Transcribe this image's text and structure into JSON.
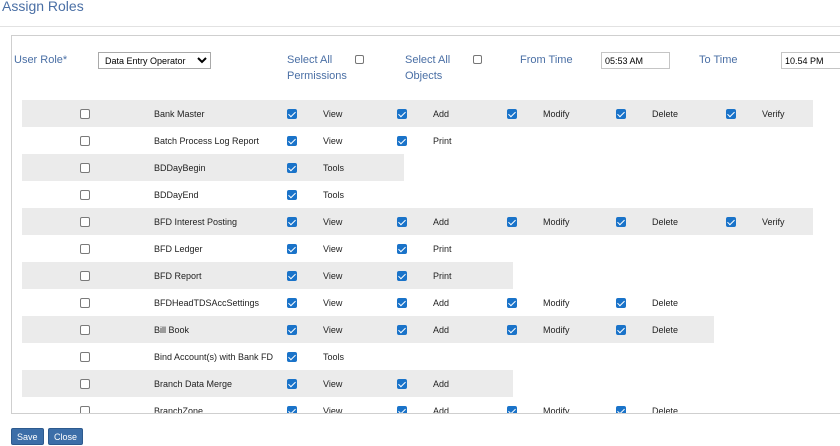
{
  "page": {
    "title": "Assign Roles"
  },
  "filters": {
    "user_role_label": "User Role*",
    "user_role_value": "Data Entry Operator",
    "select_all_permissions_label_1": "Select All",
    "select_all_permissions_label_2": "Permissions",
    "select_all_objects_label_1": "Select All",
    "select_all_objects_label_2": "Objects",
    "from_time_label": "From Time",
    "from_time_value": "05:53 AM",
    "to_time_label": "To Time",
    "to_time_value": "10.54 PM"
  },
  "rows": [
    {
      "name": "Bank Master",
      "object_checked": false,
      "perms": [
        {
          "label": "View",
          "checked": true
        },
        {
          "label": "Add",
          "checked": true
        },
        {
          "label": "Modify",
          "checked": true
        },
        {
          "label": "Delete",
          "checked": true
        },
        {
          "label": "Verify",
          "checked": true
        }
      ]
    },
    {
      "name": "Batch Process Log Report",
      "object_checked": false,
      "perms": [
        {
          "label": "View",
          "checked": true
        },
        {
          "label": "Print",
          "checked": true
        }
      ]
    },
    {
      "name": "BDDayBegin",
      "object_checked": false,
      "perms": [
        {
          "label": "Tools",
          "checked": true
        }
      ]
    },
    {
      "name": "BDDayEnd",
      "object_checked": false,
      "perms": [
        {
          "label": "Tools",
          "checked": true
        }
      ]
    },
    {
      "name": "BFD Interest Posting",
      "object_checked": false,
      "perms": [
        {
          "label": "View",
          "checked": true
        },
        {
          "label": "Add",
          "checked": true
        },
        {
          "label": "Modify",
          "checked": true
        },
        {
          "label": "Delete",
          "checked": true
        },
        {
          "label": "Verify",
          "checked": true
        }
      ]
    },
    {
      "name": "BFD Ledger",
      "object_checked": false,
      "perms": [
        {
          "label": "View",
          "checked": true
        },
        {
          "label": "Print",
          "checked": true
        }
      ]
    },
    {
      "name": "BFD Report",
      "object_checked": false,
      "perms": [
        {
          "label": "View",
          "checked": true
        },
        {
          "label": "Print",
          "checked": true
        }
      ]
    },
    {
      "name": "BFDHeadTDSAccSettings",
      "object_checked": false,
      "perms": [
        {
          "label": "View",
          "checked": true
        },
        {
          "label": "Add",
          "checked": true
        },
        {
          "label": "Modify",
          "checked": true
        },
        {
          "label": "Delete",
          "checked": true
        }
      ]
    },
    {
      "name": "Bill Book",
      "object_checked": false,
      "perms": [
        {
          "label": "View",
          "checked": true
        },
        {
          "label": "Add",
          "checked": true
        },
        {
          "label": "Modify",
          "checked": true
        },
        {
          "label": "Delete",
          "checked": true
        }
      ]
    },
    {
      "name": "Bind Account(s) with Bank FD",
      "object_checked": false,
      "perms": [
        {
          "label": "Tools",
          "checked": true
        }
      ]
    },
    {
      "name": "Branch Data Merge",
      "object_checked": false,
      "perms": [
        {
          "label": "View",
          "checked": true
        },
        {
          "label": "Add",
          "checked": true
        }
      ]
    },
    {
      "name": "BranchZone",
      "object_checked": false,
      "perms": [
        {
          "label": "View",
          "checked": true
        },
        {
          "label": "Add",
          "checked": true
        },
        {
          "label": "Modify",
          "checked": true
        },
        {
          "label": "Delete",
          "checked": true
        }
      ]
    }
  ],
  "buttons": {
    "save": "Save",
    "close": "Close"
  },
  "colors": {
    "accent": "#4a6fa5",
    "checkbox": "#1a73c9",
    "row_alt": "#ebebeb",
    "button": "#3c6ea8"
  }
}
